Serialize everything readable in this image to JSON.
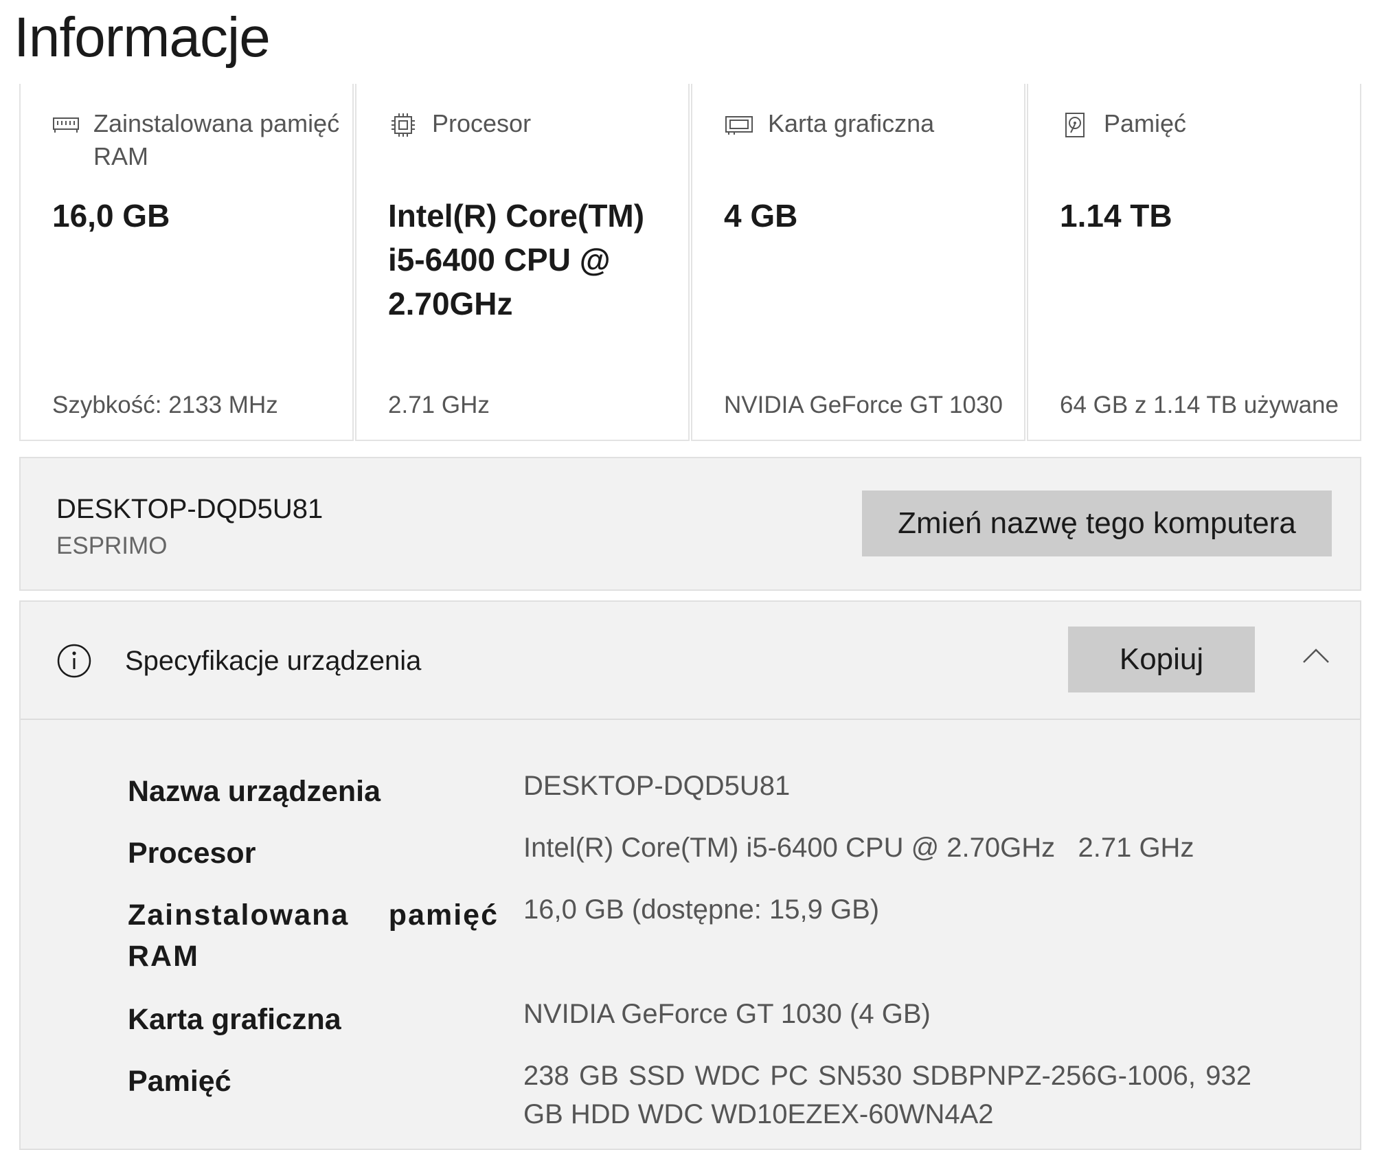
{
  "page": {
    "title": "Informacje"
  },
  "cards": [
    {
      "icon": "ram-icon",
      "label": "Zainstalowana pamięć RAM",
      "value": "16,0 GB",
      "footer": "Szybkość: 2133 MHz"
    },
    {
      "icon": "processor-icon",
      "label": "Procesor",
      "value": "Intel(R) Core(TM) i5-6400 CPU @ 2.70GHz",
      "footer": "2.71 GHz"
    },
    {
      "icon": "graphics-card-icon",
      "label": "Karta graficzna",
      "value": "4 GB",
      "footer": "NVIDIA GeForce GT 1030"
    },
    {
      "icon": "storage-icon",
      "label": "Pamięć",
      "value": "1.14 TB",
      "footer": "64 GB z 1.14 TB używane"
    }
  ],
  "device": {
    "name": "DESKTOP-DQD5U81",
    "model": "ESPRIMO",
    "rename_label": "Zmień nazwę tego komputera"
  },
  "specs": {
    "title": "Specyfikacje urządzenia",
    "copy_label": "Kopiuj",
    "rows": [
      {
        "label": "Nazwa urządzenia",
        "value": "DESKTOP-DQD5U81"
      },
      {
        "label": "Procesor",
        "value": "Intel(R) Core(TM) i5-6400 CPU @ 2.70GHz   2.71 GHz"
      },
      {
        "label": "Zainstalowana pamięć RAM",
        "value": "16,0 GB (dostępne: 15,9 GB)"
      },
      {
        "label": "Karta graficzna",
        "value": "NVIDIA GeForce GT 1030 (4 GB)"
      },
      {
        "label": "Pamięć",
        "value": "238 GB SSD WDC PC SN530 SDBPNPZ-256G-1006, 932 GB HDD WDC WD10EZEX-60WN4A2"
      }
    ]
  }
}
